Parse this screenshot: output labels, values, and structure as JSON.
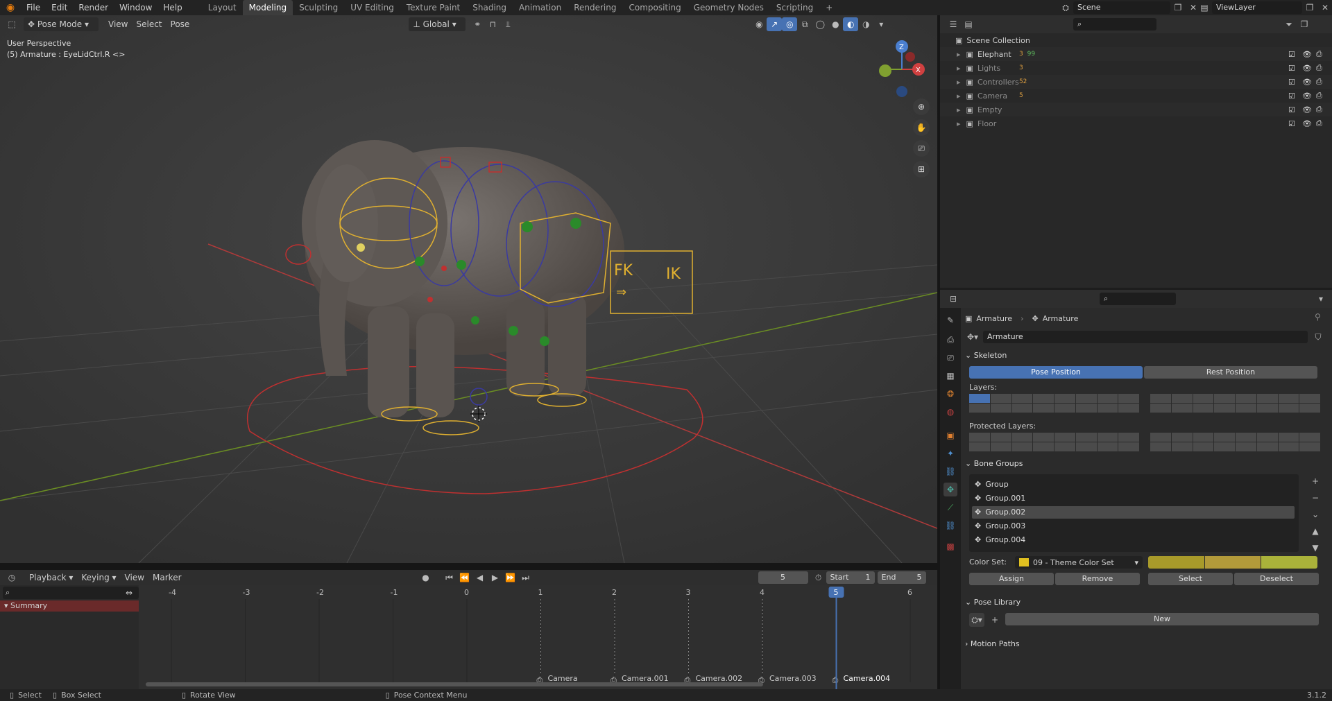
{
  "topbar": {
    "menus": [
      "File",
      "Edit",
      "Render",
      "Window",
      "Help"
    ],
    "workspaces": [
      "Layout",
      "Modeling",
      "Sculpting",
      "UV Editing",
      "Texture Paint",
      "Shading",
      "Animation",
      "Rendering",
      "Compositing",
      "Geometry Nodes",
      "Scripting"
    ],
    "active_workspace": "Modeling",
    "add_workspace": "+",
    "scene": "Scene",
    "view_layer": "ViewLayer"
  },
  "viewport": {
    "mode": "Pose Mode",
    "menus": [
      "View",
      "Select",
      "Pose"
    ],
    "transform_orientation": "Global",
    "overlay_title": "User Perspective",
    "overlay_subtitle": "(5) Armature : EyeLidCtrl.R <>",
    "fk_label": "FK",
    "ik_label": "IK"
  },
  "outliner": {
    "root": "Scene Collection",
    "rows": [
      {
        "name": "Elephant",
        "badge1": "3",
        "badge2": "99",
        "color": "#cccccc"
      },
      {
        "name": "Lights",
        "badge1": "3",
        "badge2": "",
        "color": "#8e8e8e"
      },
      {
        "name": "Controllers",
        "badge1": "52",
        "badge2": "",
        "color": "#8e8e8e"
      },
      {
        "name": "Camera",
        "badge1": "5",
        "badge2": "",
        "color": "#8e8e8e"
      },
      {
        "name": "Empty",
        "badge1": "",
        "badge2": "",
        "color": "#8e8e8e"
      },
      {
        "name": "Floor",
        "badge1": "",
        "badge2": "",
        "color": "#8e8e8e"
      }
    ]
  },
  "properties": {
    "breadcrumb_object": "Armature",
    "breadcrumb_data": "Armature",
    "data_name": "Armature",
    "skeleton": {
      "title": "Skeleton",
      "pose_position": "Pose Position",
      "rest_position": "Rest Position",
      "layers_label": "Layers:",
      "protected_layers_label": "Protected Layers:"
    },
    "bone_groups": {
      "title": "Bone Groups",
      "items": [
        "Group",
        "Group.001",
        "Group.002",
        "Group.003",
        "Group.004"
      ],
      "selected": "Group.002",
      "color_set_label": "Color Set:",
      "color_set_value": "09 - Theme Color Set",
      "assign": "Assign",
      "remove": "Remove",
      "select": "Select",
      "deselect": "Deselect",
      "colors": [
        "#a89a2a",
        "#b29a3a",
        "#aab23a"
      ]
    },
    "pose_library": {
      "title": "Pose Library",
      "new": "New"
    },
    "motion_paths": {
      "title": "Motion Paths"
    }
  },
  "timeline": {
    "menus": [
      "Playback",
      "Keying",
      "View",
      "Marker"
    ],
    "current_frame": "5",
    "start_label": "Start",
    "start_value": "1",
    "end_label": "End",
    "end_value": "5",
    "summary": "Summary",
    "frame_ticks": [
      "-4",
      "-3",
      "-2",
      "-1",
      "0",
      "1",
      "2",
      "3",
      "4",
      "5",
      "6"
    ],
    "markers": [
      "Camera",
      "Camera.001",
      "Camera.002",
      "Camera.003",
      "Camera.004"
    ]
  },
  "statusbar": {
    "items": [
      "Select",
      "Box Select",
      "Rotate View",
      "Pose Context Menu"
    ],
    "version": "3.1.2"
  }
}
